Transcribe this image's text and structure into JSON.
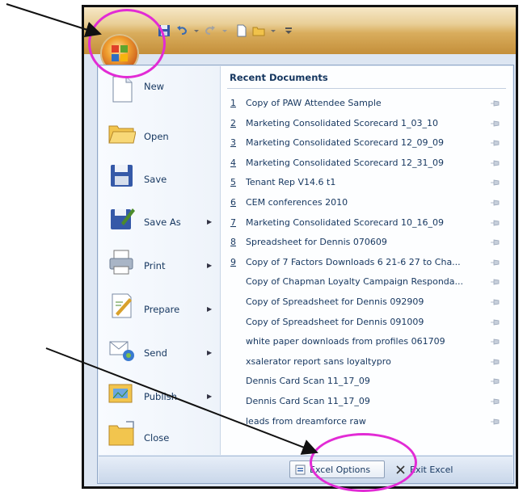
{
  "quick_access": {
    "items": [
      {
        "icon": "save-icon"
      },
      {
        "icon": "undo-icon"
      },
      {
        "icon": "redo-icon"
      },
      {
        "icon": "new-document-icon"
      },
      {
        "icon": "open-folder-icon"
      },
      {
        "icon": "customize-dropdown-icon"
      }
    ]
  },
  "office_button": {
    "icon": "office-logo-icon"
  },
  "left_menu": {
    "items": [
      {
        "label": "New",
        "underline": "N",
        "icon": "new-document-icon",
        "submenu": false
      },
      {
        "label": "Open",
        "underline": "O",
        "icon": "open-folder-icon",
        "submenu": false
      },
      {
        "label": "Save",
        "underline": "S",
        "icon": "floppy-disk-icon",
        "submenu": false
      },
      {
        "label": "Save As",
        "underline": "A",
        "icon": "save-as-icon",
        "submenu": true
      },
      {
        "label": "Print",
        "underline": "P",
        "icon": "printer-icon",
        "submenu": true
      },
      {
        "label": "Prepare",
        "underline": "e",
        "icon": "prepare-icon",
        "submenu": true
      },
      {
        "label": "Send",
        "underline": "d",
        "icon": "send-icon",
        "submenu": true
      },
      {
        "label": "Publish",
        "underline": "u",
        "icon": "publish-icon",
        "submenu": true
      },
      {
        "label": "Close",
        "underline": "C",
        "icon": "close-folder-icon",
        "submenu": false
      }
    ]
  },
  "recent_documents": {
    "title": "Recent Documents",
    "items": [
      {
        "num": "1",
        "name": "Copy of PAW Attendee Sample"
      },
      {
        "num": "2",
        "name": "Marketing Consolidated Scorecard 1_03_10"
      },
      {
        "num": "3",
        "name": "Marketing Consolidated Scorecard 12_09_09"
      },
      {
        "num": "4",
        "name": "Marketing Consolidated Scorecard 12_31_09"
      },
      {
        "num": "5",
        "name": "Tenant Rep V14.6 t1"
      },
      {
        "num": "6",
        "name": "CEM conferences 2010"
      },
      {
        "num": "7",
        "name": "Marketing Consolidated Scorecard 10_16_09"
      },
      {
        "num": "8",
        "name": "Spreadsheet for Dennis 070609"
      },
      {
        "num": "9",
        "name": "Copy of 7 Factors Downloads 6 21-6 27 to Cha..."
      },
      {
        "num": "",
        "name": "Copy of Chapman Loyalty Campaign Responda..."
      },
      {
        "num": "",
        "name": "Copy of Spreadsheet for Dennis 092909"
      },
      {
        "num": "",
        "name": "Copy of Spreadsheet for Dennis 091009"
      },
      {
        "num": "",
        "name": "white paper downloads from profiles 061709"
      },
      {
        "num": "",
        "name": "xsalerator report sans loyaltypro"
      },
      {
        "num": "",
        "name": "Dennis Card Scan 11_17_09"
      },
      {
        "num": "",
        "name": "Dennis Card Scan 11_17_09"
      },
      {
        "num": "",
        "name": "leads from dreamforce raw"
      }
    ]
  },
  "bottom_bar": {
    "options_label": "Excel Options",
    "exit_label": "Exit Excel"
  },
  "annotation": {
    "color": "#e22bd5",
    "arrow_color": "#111111"
  }
}
